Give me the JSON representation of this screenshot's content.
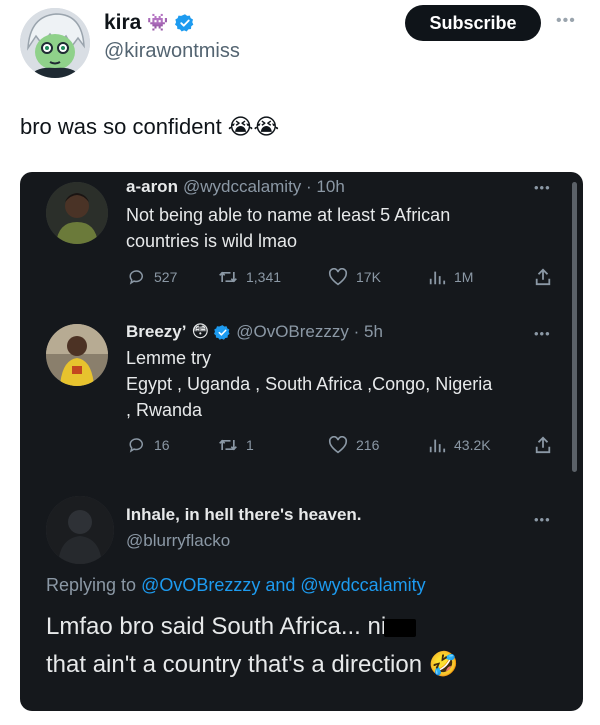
{
  "author": {
    "display_name": "kira",
    "name_emoji": "👾",
    "handle": "@kirawontmiss"
  },
  "subscribe_label": "Subscribe",
  "more_label": "•••",
  "tweet_text": "bro was so confident",
  "tweet_emojis": "😭😭",
  "screenshot": {
    "tweet1": {
      "name": "a-aron",
      "handle_time": "@wydccalamity · 10h",
      "lines": [
        "Not being able to name at least 5 African",
        "countries is wild lmao"
      ],
      "replies": "527",
      "retweets": "1,341",
      "likes": "17K",
      "views": "1M",
      "more": "•••"
    },
    "tweet2": {
      "name": "Breezy’",
      "name_emoji": "😳",
      "handle_time": "@OvOBrezzzy · 5h",
      "lines": [
        "Lemme try",
        "Egypt , Uganda , South Africa ,Congo, Nigeria",
        ", Rwanda"
      ],
      "replies": "16",
      "retweets": "1",
      "likes": "216",
      "views": "43.2K",
      "more": "•••"
    },
    "tweet3": {
      "name": "Inhale, in hell there's heaven.",
      "handle": "@blurryflacko",
      "more": "•••",
      "replying_prefix": "Replying to ",
      "replying_mentions": "@OvOBrezzzy and @wydccalamity",
      "line1_start": "Lmfao bro said South Africa... ni",
      "line2": "that ain't a country that's a direction",
      "line2_emoji": "🤣"
    }
  },
  "colors": {
    "verified": "#1d9bf0",
    "dark_bg": "#15181c",
    "subscribe_bg": "#0f1419",
    "muted": "#8b98a5",
    "link": "#1d9bf0"
  }
}
